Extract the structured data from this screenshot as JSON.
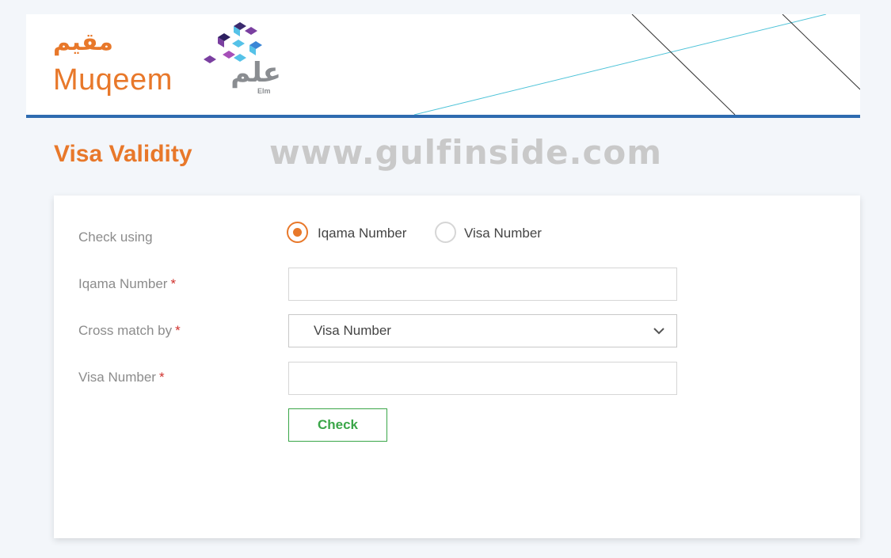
{
  "header": {
    "logo_arabic": "مقيم",
    "logo_latin": "Muqeem",
    "partner_arabic": "علم",
    "partner_latin": "Elm"
  },
  "page": {
    "title": "Visa Validity",
    "watermark": "www.gulfinside.com"
  },
  "form": {
    "check_using": {
      "label": "Check using",
      "options": [
        "Iqama Number",
        "Visa Number"
      ],
      "selected": "Iqama Number"
    },
    "iqama_number": {
      "label": "Iqama Number",
      "value": ""
    },
    "cross_match": {
      "label": "Cross match by",
      "value": "Visa Number"
    },
    "visa_number": {
      "label": "Visa Number",
      "value": ""
    },
    "required_mark": "*",
    "check_label": "Check"
  },
  "colors": {
    "brand_orange": "#e8782a",
    "header_rule": "#2e6bb0",
    "button_green": "#3aa648",
    "required_red": "#d0312d"
  },
  "icons": [
    "elm-logo-icon",
    "chevron-down-icon"
  ]
}
